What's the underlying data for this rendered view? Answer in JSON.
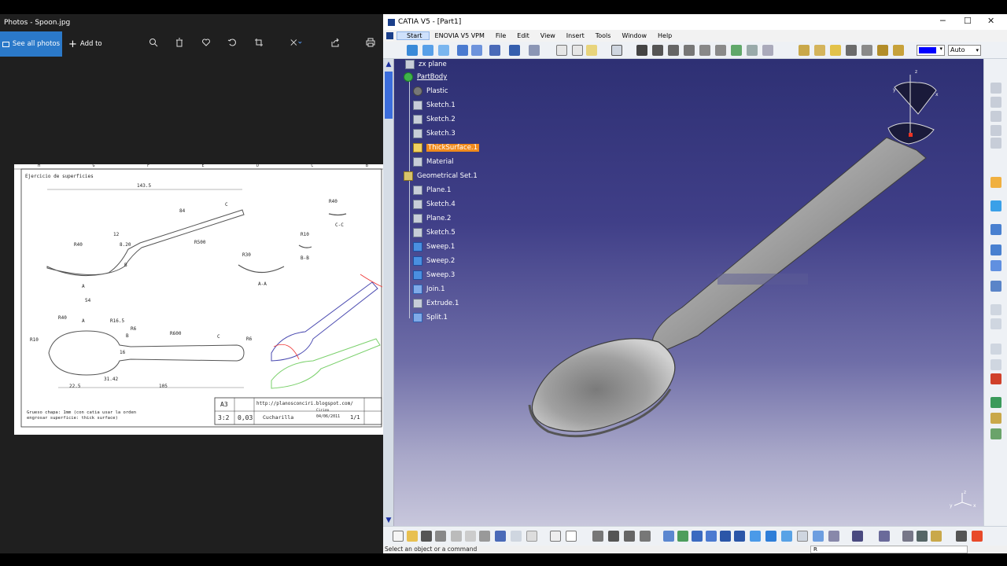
{
  "photos": {
    "title": "Photos - Spoon.jpg",
    "see_all": "See all photos",
    "add_to": "Add to",
    "tools": [
      "zoom-icon",
      "delete-icon",
      "favorite-icon",
      "rotate-icon",
      "crop-icon",
      "edit-icon",
      "share-icon",
      "print-icon"
    ]
  },
  "drawing": {
    "heading": "Ejercicio de superficies",
    "col_labels": [
      "H",
      "G",
      "F",
      "E",
      "D",
      "C",
      "B"
    ],
    "dims": {
      "d1435": "143.5",
      "d84": "84",
      "dC1": "C",
      "dR40a": "R40",
      "d12": "12",
      "d820": "8.20",
      "dR500": "R500",
      "dB1": "B",
      "dA1": "A",
      "d54": "54",
      "dR40b": "R40",
      "dCC": "C-C",
      "dR10a": "R10",
      "dBB": "B-B",
      "dR30": "R30",
      "dAA": "A-A",
      "dR40c": "R40",
      "dA2": "A",
      "dR165": "R16.5",
      "dR6a": "R6",
      "dR10b": "R10",
      "dB2": "B",
      "dR600": "R600",
      "dC2": "C",
      "dR6b": "R6",
      "d16": "16",
      "d225": "22.5",
      "d3142": "31.42",
      "d105": "105"
    },
    "note1": "Grueso chapa: 1mm  (con catia usar la orden",
    "note2": "engrosar superficie: thick surface)",
    "tb_format": "A3",
    "tb_scale": "3:2",
    "tb_weight": "0,03",
    "tb_url": "http://planosconciri.blogspot.com/",
    "tb_author": "Ciriло",
    "tb_date": "04/06/2011",
    "tb_name": "Cucharilla",
    "tb_sheet": "1/1"
  },
  "catia": {
    "title": "CATIA V5 - [Part1]",
    "menu": [
      "Start",
      "ENOVIA V5 VPM",
      "File",
      "Edit",
      "View",
      "Insert",
      "Tools",
      "Window",
      "Help"
    ],
    "color_mode": "Auto",
    "status": "Select an object or a command",
    "command_value": "R",
    "tree": [
      {
        "label": "zx plane",
        "icon": "plane-icon",
        "underline": false,
        "selected": false
      },
      {
        "label": "PartBody",
        "icon": "partbody-icon",
        "underline": true,
        "selected": false
      },
      {
        "label": "Plastic",
        "icon": "material-icon",
        "underline": false,
        "selected": false
      },
      {
        "label": "Sketch.1",
        "icon": "sketch-icon",
        "underline": false,
        "selected": false
      },
      {
        "label": "Sketch.2",
        "icon": "sketch-icon",
        "underline": false,
        "selected": false
      },
      {
        "label": "Sketch.3",
        "icon": "sketch-icon",
        "underline": false,
        "selected": false
      },
      {
        "label": "ThickSurface.1",
        "icon": "thicksurface-icon",
        "underline": false,
        "selected": true
      },
      {
        "label": "Material",
        "icon": "material-catalog-icon",
        "underline": false,
        "selected": false
      },
      {
        "label": "Geometrical Set.1",
        "icon": "geometrical-set-icon",
        "underline": false,
        "selected": false
      },
      {
        "label": "Plane.1",
        "icon": "plane-icon",
        "underline": false,
        "selected": false
      },
      {
        "label": "Sketch.4",
        "icon": "sketch-icon",
        "underline": false,
        "selected": false
      },
      {
        "label": "Plane.2",
        "icon": "plane-icon",
        "underline": false,
        "selected": false
      },
      {
        "label": "Sketch.5",
        "icon": "sketch-icon",
        "underline": false,
        "selected": false
      },
      {
        "label": "Sweep.1",
        "icon": "sweep-icon",
        "underline": false,
        "selected": false
      },
      {
        "label": "Sweep.2",
        "icon": "sweep-icon",
        "underline": false,
        "selected": false
      },
      {
        "label": "Sweep.3",
        "icon": "sweep-icon",
        "underline": false,
        "selected": false
      },
      {
        "label": "Join.1",
        "icon": "join-icon",
        "underline": false,
        "selected": false
      },
      {
        "label": "Extrude.1",
        "icon": "extrude-icon",
        "underline": false,
        "selected": false
      },
      {
        "label": "Split.1",
        "icon": "split-icon",
        "underline": false,
        "selected": false
      }
    ],
    "compass_z": "z",
    "compass_y": "y",
    "compass_x": "x",
    "axis_z": "z",
    "axis_y": "y",
    "axis_x": "x",
    "colors": {
      "background_top": "#2e3074",
      "background_bottom": "#c8c7dc",
      "selection": "#f08a1c",
      "color_swatch": "#0000ff"
    }
  }
}
